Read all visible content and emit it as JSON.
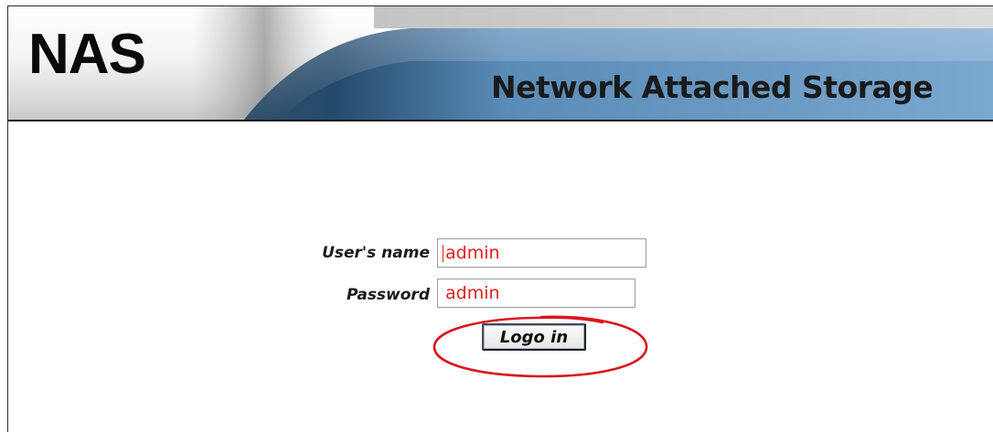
{
  "header": {
    "logo_text": "NAS",
    "tagline": "Network Attached Storage"
  },
  "login": {
    "username_label": "User's name",
    "username_value": "admin",
    "password_label": "Password",
    "password_value": "admin",
    "login_button_label": "Logo in"
  },
  "colors": {
    "banner_blue": "#6a9bc3",
    "banner_dark_blue": "#3c6f99",
    "input_text": "#e02020",
    "highlight_ellipse": "#d9161c"
  },
  "annotations": {
    "highlight_target": "login-button"
  }
}
